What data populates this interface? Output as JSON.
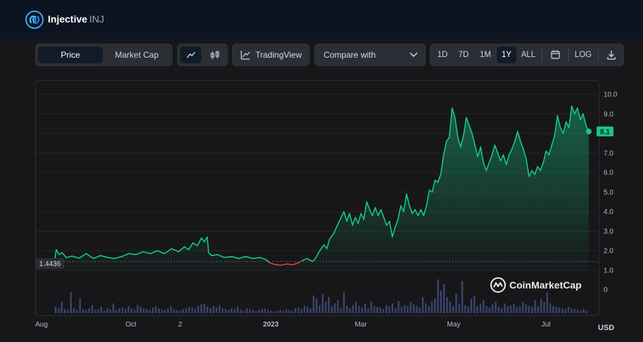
{
  "coin": {
    "name": "Injective",
    "symbol": "INJ"
  },
  "toolbar": {
    "price_label": "Price",
    "marketcap_label": "Market Cap",
    "tradingview_label": "TradingView",
    "compare_label": "Compare with",
    "timeframes": [
      "1D",
      "7D",
      "1M",
      "1Y",
      "ALL"
    ],
    "active_timeframe": "1Y",
    "log_label": "LOG"
  },
  "watermark": "CoinMarketCap",
  "currency": "USD",
  "colors": {
    "up": "#16c784",
    "down": "#ea3943",
    "accent": "#16c784"
  },
  "chart_data": {
    "type": "area",
    "yaxis_ticks": [
      "10.0",
      "9.0",
      "8.0",
      "7.0",
      "6.0",
      "5.0",
      "4.0",
      "3.0",
      "2.0",
      "1.0"
    ],
    "volume_tick": "0",
    "ylim": [
      0.5,
      10.5
    ],
    "xaxis_labels": [
      "Aug",
      "Oct",
      "2",
      "2023",
      "Mar",
      "May",
      "Jul"
    ],
    "baseline_value": 1.4436,
    "baseline_label": "1.4436",
    "current_price": 8.1,
    "current_label": "8.1",
    "grid": true,
    "series": [
      {
        "x": 0,
        "y": 1.6
      },
      {
        "x": 1,
        "y": 2.05
      },
      {
        "x": 3,
        "y": 1.8
      },
      {
        "x": 5,
        "y": 1.9
      },
      {
        "x": 8,
        "y": 1.65
      },
      {
        "x": 12,
        "y": 1.72
      },
      {
        "x": 17,
        "y": 1.62
      },
      {
        "x": 22,
        "y": 1.85
      },
      {
        "x": 27,
        "y": 1.6
      },
      {
        "x": 32,
        "y": 1.75
      },
      {
        "x": 37,
        "y": 1.65
      },
      {
        "x": 42,
        "y": 1.6
      },
      {
        "x": 47,
        "y": 1.7
      },
      {
        "x": 52,
        "y": 1.85
      },
      {
        "x": 57,
        "y": 1.8
      },
      {
        "x": 62,
        "y": 1.95
      },
      {
        "x": 67,
        "y": 1.85
      },
      {
        "x": 72,
        "y": 2.0
      },
      {
        "x": 77,
        "y": 1.85
      },
      {
        "x": 82,
        "y": 2.1
      },
      {
        "x": 87,
        "y": 1.95
      },
      {
        "x": 91,
        "y": 2.2
      },
      {
        "x": 94,
        "y": 2.05
      },
      {
        "x": 97,
        "y": 2.4
      },
      {
        "x": 100,
        "y": 2.25
      },
      {
        "x": 103,
        "y": 2.65
      },
      {
        "x": 105,
        "y": 2.45
      },
      {
        "x": 107,
        "y": 2.7
      },
      {
        "x": 108,
        "y": 1.9
      },
      {
        "x": 110,
        "y": 1.75
      },
      {
        "x": 114,
        "y": 1.8
      },
      {
        "x": 119,
        "y": 1.65
      },
      {
        "x": 124,
        "y": 1.7
      },
      {
        "x": 129,
        "y": 1.6
      },
      {
        "x": 134,
        "y": 1.7
      },
      {
        "x": 139,
        "y": 1.6
      },
      {
        "x": 144,
        "y": 1.65
      },
      {
        "x": 148,
        "y": 1.55
      },
      {
        "x": 151,
        "y": 1.38
      },
      {
        "x": 155,
        "y": 1.28
      },
      {
        "x": 159,
        "y": 1.26
      },
      {
        "x": 163,
        "y": 1.32
      },
      {
        "x": 167,
        "y": 1.28
      },
      {
        "x": 171,
        "y": 1.38
      },
      {
        "x": 174,
        "y": 1.5
      },
      {
        "x": 177,
        "y": 1.6
      },
      {
        "x": 181,
        "y": 1.45
      },
      {
        "x": 183,
        "y": 1.6
      },
      {
        "x": 186,
        "y": 2.0
      },
      {
        "x": 189,
        "y": 2.3
      },
      {
        "x": 191,
        "y": 2.1
      },
      {
        "x": 193,
        "y": 2.6
      },
      {
        "x": 196,
        "y": 2.9
      },
      {
        "x": 199,
        "y": 3.4
      },
      {
        "x": 201,
        "y": 3.7
      },
      {
        "x": 203,
        "y": 4.0
      },
      {
        "x": 205,
        "y": 3.5
      },
      {
        "x": 207,
        "y": 3.9
      },
      {
        "x": 209,
        "y": 3.3
      },
      {
        "x": 211,
        "y": 3.7
      },
      {
        "x": 213,
        "y": 3.4
      },
      {
        "x": 215,
        "y": 3.9
      },
      {
        "x": 217,
        "y": 3.6
      },
      {
        "x": 219,
        "y": 4.5
      },
      {
        "x": 221,
        "y": 4.1
      },
      {
        "x": 223,
        "y": 3.8
      },
      {
        "x": 225,
        "y": 4.2
      },
      {
        "x": 227,
        "y": 3.8
      },
      {
        "x": 229,
        "y": 4.1
      },
      {
        "x": 231,
        "y": 3.7
      },
      {
        "x": 233,
        "y": 3.3
      },
      {
        "x": 235,
        "y": 3.5
      },
      {
        "x": 237,
        "y": 2.7
      },
      {
        "x": 239,
        "y": 3.2
      },
      {
        "x": 241,
        "y": 3.6
      },
      {
        "x": 243,
        "y": 4.3
      },
      {
        "x": 245,
        "y": 4.0
      },
      {
        "x": 247,
        "y": 4.9
      },
      {
        "x": 249,
        "y": 4.3
      },
      {
        "x": 251,
        "y": 3.9
      },
      {
        "x": 253,
        "y": 4.1
      },
      {
        "x": 255,
        "y": 3.8
      },
      {
        "x": 257,
        "y": 4.1
      },
      {
        "x": 259,
        "y": 3.8
      },
      {
        "x": 261,
        "y": 4.3
      },
      {
        "x": 263,
        "y": 5.1
      },
      {
        "x": 265,
        "y": 5.0
      },
      {
        "x": 267,
        "y": 5.6
      },
      {
        "x": 269,
        "y": 5.5
      },
      {
        "x": 271,
        "y": 5.9
      },
      {
        "x": 273,
        "y": 6.9
      },
      {
        "x": 275,
        "y": 7.6
      },
      {
        "x": 277,
        "y": 7.8
      },
      {
        "x": 279,
        "y": 9.3
      },
      {
        "x": 281,
        "y": 8.8
      },
      {
        "x": 283,
        "y": 7.8
      },
      {
        "x": 285,
        "y": 7.3
      },
      {
        "x": 287,
        "y": 7.9
      },
      {
        "x": 289,
        "y": 8.8
      },
      {
        "x": 291,
        "y": 8.4
      },
      {
        "x": 293,
        "y": 8.0
      },
      {
        "x": 295,
        "y": 7.4
      },
      {
        "x": 297,
        "y": 6.8
      },
      {
        "x": 299,
        "y": 7.3
      },
      {
        "x": 301,
        "y": 6.5
      },
      {
        "x": 303,
        "y": 6.1
      },
      {
        "x": 305,
        "y": 6.5
      },
      {
        "x": 307,
        "y": 6.9
      },
      {
        "x": 309,
        "y": 7.4
      },
      {
        "x": 311,
        "y": 7.0
      },
      {
        "x": 313,
        "y": 6.6
      },
      {
        "x": 315,
        "y": 6.9
      },
      {
        "x": 317,
        "y": 6.4
      },
      {
        "x": 319,
        "y": 6.9
      },
      {
        "x": 321,
        "y": 7.2
      },
      {
        "x": 323,
        "y": 7.6
      },
      {
        "x": 325,
        "y": 8.1
      },
      {
        "x": 327,
        "y": 7.6
      },
      {
        "x": 329,
        "y": 7.2
      },
      {
        "x": 331,
        "y": 6.7
      },
      {
        "x": 333,
        "y": 5.8
      },
      {
        "x": 335,
        "y": 6.1
      },
      {
        "x": 337,
        "y": 5.9
      },
      {
        "x": 339,
        "y": 6.3
      },
      {
        "x": 341,
        "y": 6.1
      },
      {
        "x": 343,
        "y": 6.5
      },
      {
        "x": 345,
        "y": 7.1
      },
      {
        "x": 347,
        "y": 6.9
      },
      {
        "x": 349,
        "y": 7.4
      },
      {
        "x": 351,
        "y": 7.9
      },
      {
        "x": 353,
        "y": 8.9
      },
      {
        "x": 355,
        "y": 8.3
      },
      {
        "x": 357,
        "y": 8.0
      },
      {
        "x": 359,
        "y": 8.6
      },
      {
        "x": 361,
        "y": 8.3
      },
      {
        "x": 363,
        "y": 9.4
      },
      {
        "x": 365,
        "y": 9.0
      },
      {
        "x": 367,
        "y": 9.3
      },
      {
        "x": 369,
        "y": 8.7
      },
      {
        "x": 371,
        "y": 9.0
      },
      {
        "x": 373,
        "y": 8.4
      },
      {
        "x": 375,
        "y": 8.1
      }
    ],
    "volume": [
      8,
      6,
      14,
      5,
      4,
      26,
      6,
      4,
      18,
      5,
      4,
      6,
      10,
      4,
      5,
      8,
      3,
      6,
      5,
      12,
      4,
      6,
      7,
      5,
      9,
      6,
      4,
      10,
      8,
      6,
      5,
      4,
      7,
      9,
      6,
      5,
      4,
      6,
      8,
      5,
      4,
      3,
      5,
      6,
      8,
      7,
      5,
      9,
      11,
      12,
      8,
      6,
      9,
      7,
      10,
      6,
      5,
      4,
      6,
      5,
      8,
      4,
      3,
      6,
      5,
      4,
      3,
      4,
      5,
      6,
      4,
      3,
      2,
      3,
      4,
      3,
      5,
      4,
      3,
      6,
      7,
      5,
      9,
      8,
      6,
      22,
      18,
      10,
      24,
      14,
      20,
      9,
      12,
      16,
      7,
      26,
      9,
      6,
      10,
      14,
      9,
      7,
      12,
      6,
      15,
      9,
      8,
      7,
      5,
      10,
      8,
      12,
      6,
      15,
      8,
      10,
      9,
      14,
      11,
      9,
      7,
      20,
      12,
      9,
      15,
      18,
      42,
      28,
      36,
      20,
      14,
      9,
      24,
      12,
      40,
      10,
      8,
      18,
      22,
      9,
      12,
      16,
      9,
      7,
      11,
      14,
      8,
      6,
      12,
      9,
      10,
      12,
      8,
      9,
      14,
      11,
      9,
      8,
      16,
      9,
      18,
      14,
      26,
      12,
      9,
      8,
      7,
      6,
      5,
      8,
      6,
      5,
      4,
      3,
      5,
      3
    ]
  }
}
